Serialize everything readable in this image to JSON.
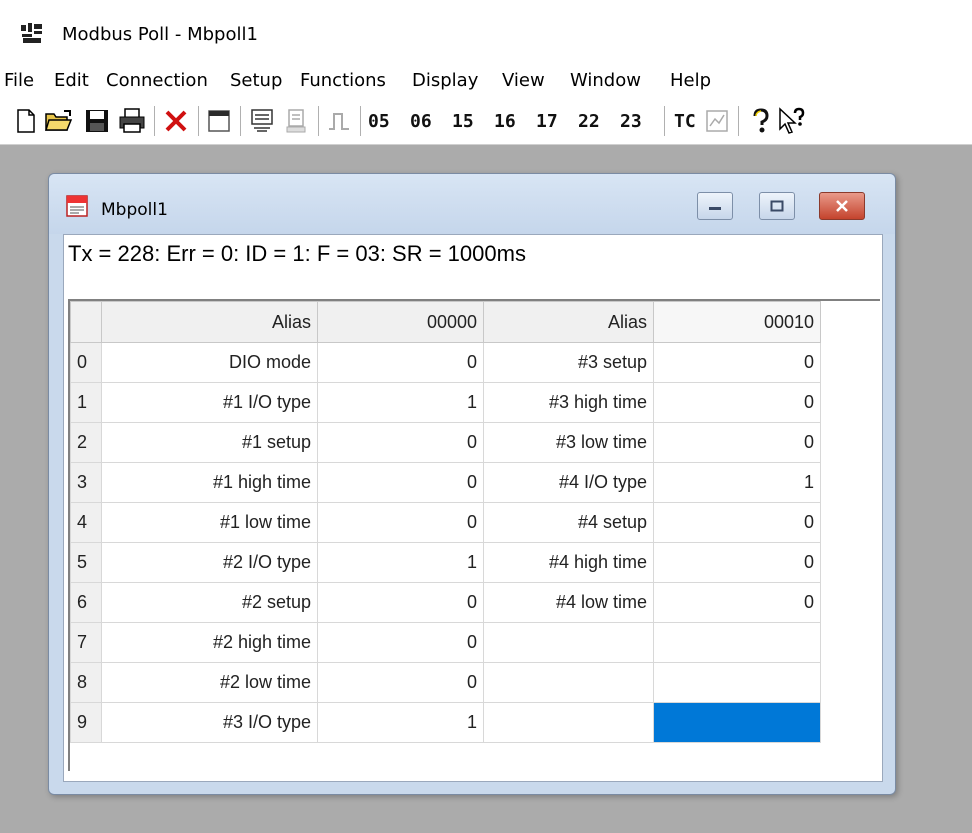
{
  "app": {
    "title": "Modbus Poll - Mbpoll1"
  },
  "menu": [
    "File",
    "Edit",
    "Connection",
    "Setup",
    "Functions",
    "Display",
    "View",
    "Window",
    "Help"
  ],
  "toolbar": {
    "function_codes": [
      "05",
      "06",
      "15",
      "16",
      "17",
      "22",
      "23"
    ],
    "tc_label": "TC",
    "help_label": "?",
    "whats_this_label": "N?"
  },
  "window": {
    "title": "Mbpoll1",
    "status": "Tx = 228: Err = 0: ID = 1: F = 03: SR = 1000ms"
  },
  "grid": {
    "headers": [
      "Alias",
      "00000",
      "Alias",
      "00010"
    ],
    "rows": [
      {
        "index": "0",
        "alias1": "DIO mode",
        "value1": "0",
        "alias2": "#3 setup",
        "value2": "0"
      },
      {
        "index": "1",
        "alias1": "#1 I/O type",
        "value1": "1",
        "alias2": "#3 high time",
        "value2": "0"
      },
      {
        "index": "2",
        "alias1": "#1 setup",
        "value1": "0",
        "alias2": "#3 low time",
        "value2": "0"
      },
      {
        "index": "3",
        "alias1": "#1 high time",
        "value1": "0",
        "alias2": "#4 I/O type",
        "value2": "1"
      },
      {
        "index": "4",
        "alias1": "#1 low time",
        "value1": "0",
        "alias2": "#4 setup",
        "value2": "0"
      },
      {
        "index": "5",
        "alias1": "#2 I/O type",
        "value1": "1",
        "alias2": "#4 high time",
        "value2": "0"
      },
      {
        "index": "6",
        "alias1": "#2 setup",
        "value1": "0",
        "alias2": "#4 low time",
        "value2": "0"
      },
      {
        "index": "7",
        "alias1": "#2 high time",
        "value1": "0",
        "alias2": "",
        "value2": ""
      },
      {
        "index": "8",
        "alias1": "#2 low time",
        "value1": "0",
        "alias2": "",
        "value2": ""
      },
      {
        "index": "9",
        "alias1": "#3 I/O type",
        "value1": "1",
        "alias2": "",
        "value2": ""
      }
    ]
  },
  "colors": {
    "workspace": "#ababab",
    "selection": "#0078d7",
    "close_button": "#c4432d"
  }
}
